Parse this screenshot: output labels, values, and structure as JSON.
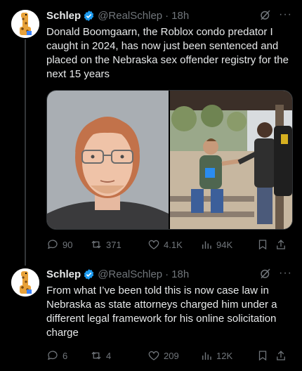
{
  "tweets": [
    {
      "author": "Schlep",
      "handle": "@RealSchlep",
      "time": "18h",
      "text": "Donald Boomgaarn, the Roblox condo predator I caught in 2024, has now just been sentenced and placed on the Nebraska sex offender registry for the next 15 years",
      "stats": {
        "replies": "90",
        "reposts": "371",
        "likes": "4.1K",
        "views": "94K"
      }
    },
    {
      "author": "Schlep",
      "handle": "@RealSchlep",
      "time": "18h",
      "text": "From what I’ve been told this is now case law in Nebraska as state attorneys charged him under a different legal framework for his online solicitation charge",
      "stats": {
        "replies": "6",
        "reposts": "4",
        "likes": "209",
        "views": "12K"
      }
    }
  ],
  "icons": {
    "verified": "verified-badge-icon",
    "grok": "grok-icon",
    "more": "more-icon",
    "reply": "reply-icon",
    "repost": "repost-icon",
    "like": "like-icon",
    "views": "views-icon",
    "bookmark": "bookmark-icon",
    "share": "share-icon"
  },
  "colors": {
    "background": "#000000",
    "text": "#e7e9ea",
    "muted": "#71767b",
    "verified": "#1d9bf0"
  }
}
